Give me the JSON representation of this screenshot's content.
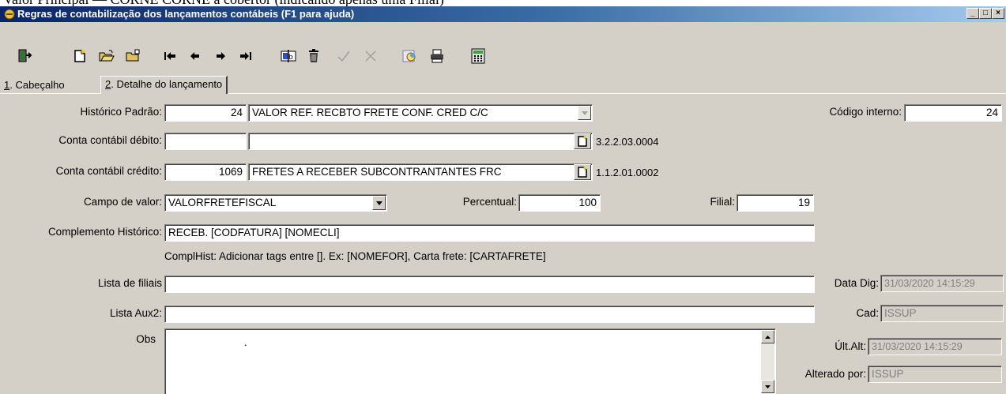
{
  "page_top_text": "Valor Principal — CORNE CORNE a cobertor (indicando apenas uma Filial)",
  "window": {
    "title": "Regras de contabilização dos lançamentos contábeis (F1 para ajuda)",
    "minimize": "_",
    "maximize": "□",
    "close": "×"
  },
  "toolbar": {
    "icons": [
      "exit-icon",
      "new-icon",
      "open-icon",
      "edit-icon",
      "first-icon",
      "prev-icon",
      "next-icon",
      "last-icon",
      "field-edit-icon",
      "delete-icon",
      "confirm-icon",
      "cancel-icon",
      "search-icon",
      "print-icon",
      "calculator-icon"
    ]
  },
  "tabs": [
    {
      "hotkey": "1",
      "label": ". Cabeçalho"
    },
    {
      "hotkey": "2",
      "label": ". Detalhe do lançamento"
    }
  ],
  "form": {
    "historico_label": "Histórico Padrão:",
    "historico_code": "24",
    "historico_desc": "VALOR REF. RECBTO FRETE CONF. CRED C/C",
    "codigo_interno_label": "Código interno:",
    "codigo_interno": "24",
    "debito_label": "Conta contábil débito:",
    "debito_code": "",
    "debito_desc": "",
    "debito_account": "3.2.2.03.0004",
    "credito_label": "Conta contábil crédito:",
    "credito_code": "1069",
    "credito_desc": "FRETES A RECEBER SUBCONTRANTANTES FRC",
    "credito_account": "1.1.2.01.0002",
    "campo_label": "Campo de valor:",
    "campo_value": "VALORFRETEFISCAL",
    "percentual_label": "Percentual:",
    "percentual_value": "100",
    "filial_label": "Filial:",
    "filial_value": "19",
    "complemento_label": "Complemento Histórico:",
    "complemento_value": "RECEB. [CODFATURA] [NOMECLI]",
    "hint": "ComplHist: Adicionar tags entre []. Ex: [NOMEFOR], Carta frete: [CARTAFRETE]",
    "lista_filiais_label": "Lista de filiais",
    "lista_filiais_value": "",
    "data_dig_label": "Data Dig:",
    "data_dig_value": "31/03/2020 14:15:29",
    "lista_aux2_label": "Lista Aux2:",
    "lista_aux2_value": "",
    "cad_label": "Cad:",
    "cad_value": "ISSUP",
    "obs_label": "Obs",
    "obs_value": ".",
    "ult_alt_label": "Últ.Alt:",
    "ult_alt_value": "31/03/2020 14:15:29",
    "alterado_label": "Alterado por:",
    "alterado_value": "ISSUP"
  }
}
